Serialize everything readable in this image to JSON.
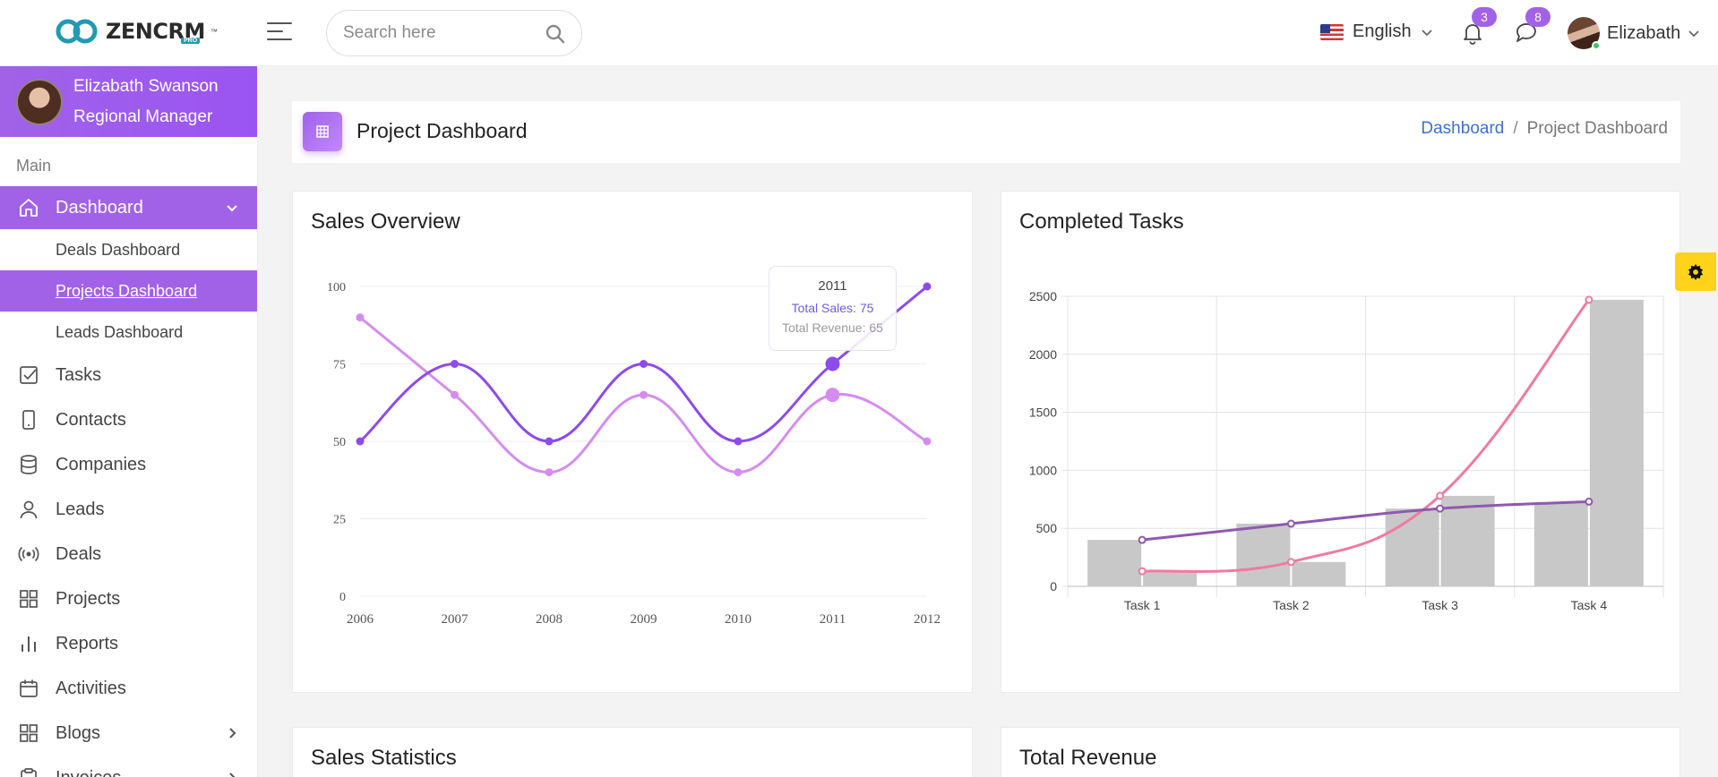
{
  "header": {
    "logo_text": "ZENCRM",
    "logo_tm": "™",
    "logo_badge": "PRO",
    "search_placeholder": "Search here",
    "language": "English",
    "notifications_count": "3",
    "messages_count": "8",
    "user_name": "Elizabath"
  },
  "sidebar": {
    "profile_name": "Elizabath Swanson",
    "profile_role": "Regional Manager",
    "section_label": "Main",
    "dashboard_label": "Dashboard",
    "sub_items": [
      "Deals Dashboard",
      "Projects Dashboard",
      "Leads Dashboard"
    ],
    "items": [
      "Tasks",
      "Contacts",
      "Companies",
      "Leads",
      "Deals",
      "Projects",
      "Reports",
      "Activities",
      "Blogs",
      "Invoices"
    ]
  },
  "page": {
    "title": "Project Dashboard",
    "breadcrumb_home": "Dashboard",
    "breadcrumb_sep": "/",
    "breadcrumb_current": "Project Dashboard"
  },
  "cards": {
    "sales_overview": "Sales Overview",
    "completed_tasks": "Completed Tasks",
    "sales_statistics": "Sales Statistics",
    "total_revenue": "Total Revenue"
  },
  "tooltip": {
    "year": "2011",
    "sales": "Total Sales: 75",
    "revenue": "Total Revenue: 65"
  },
  "colors": {
    "accent": "#a162e8",
    "sales_line": "#8d4bea",
    "revenue_line": "#d58cf0",
    "task_bar": "#c8c8c8",
    "task_pink": "#f07aa0",
    "task_purple": "#8e5aad"
  },
  "chart_data": [
    {
      "type": "line",
      "title": "Sales Overview",
      "x": [
        "2006",
        "2007",
        "2008",
        "2009",
        "2010",
        "2011",
        "2012"
      ],
      "ylim": [
        0,
        100
      ],
      "yticks": [
        "0",
        "25",
        "50",
        "75",
        "100"
      ],
      "grid": true,
      "series": [
        {
          "name": "Total Sales",
          "values": [
            50,
            75,
            50,
            75,
            50,
            75,
            100
          ]
        },
        {
          "name": "Total Revenue",
          "values": [
            90,
            65,
            40,
            65,
            40,
            65,
            50
          ]
        }
      ]
    },
    {
      "type": "bar",
      "title": "Completed Tasks",
      "categories": [
        "Task 1",
        "Task 2",
        "Task 3",
        "Task 4"
      ],
      "ylim": [
        0,
        2500
      ],
      "yticks": [
        "0",
        "500",
        "1000",
        "1500",
        "2000",
        "2500"
      ],
      "grid": true,
      "bar_series": [
        {
          "values": [
            400,
            540,
            670,
            720
          ]
        },
        {
          "values": [
            130,
            210,
            780,
            2470
          ]
        }
      ],
      "line_series": [
        {
          "values": [
            130,
            210,
            780,
            2470
          ]
        },
        {
          "values": [
            400,
            540,
            670,
            730
          ]
        }
      ]
    }
  ]
}
